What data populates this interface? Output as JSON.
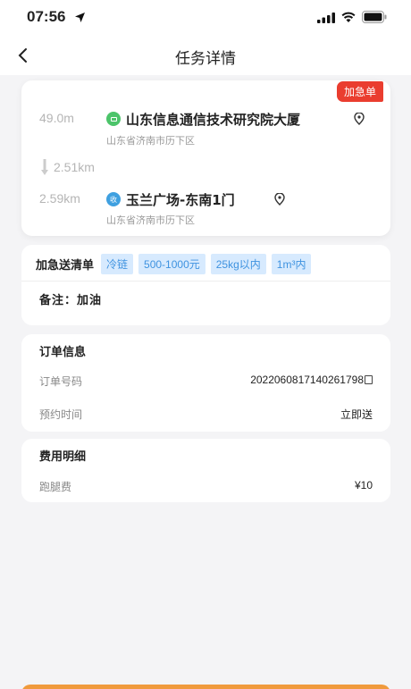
{
  "status_bar": {
    "time": "07:56"
  },
  "nav": {
    "title": "任务详情"
  },
  "route": {
    "badge": "加急单",
    "start": {
      "distance": "49.0m",
      "name": "山东信息通信技术研究院大厦",
      "region": "山东省济南市历下区",
      "icon": "pickup-icon"
    },
    "middle_distance": "2.51km",
    "end": {
      "distance": "2.59km",
      "name": "玉兰广场-东南1门",
      "region": "山东省济南市历下区",
      "icon": "receive-icon",
      "icon_text": "收"
    }
  },
  "tags": {
    "title": "加急送清单",
    "items": [
      "冷链",
      "500-1000元",
      "25kg以内",
      "1m³内"
    ],
    "note": "备注：加油"
  },
  "order": {
    "title": "订单信息",
    "rows": [
      {
        "label": "订单号码",
        "value": "20220608171402617​98"
      },
      {
        "label": "预约时间",
        "value": "立即送"
      }
    ]
  },
  "fee": {
    "title": "费用明细",
    "rows": [
      {
        "label": "跑腿费",
        "value": "¥10"
      }
    ]
  },
  "colors": {
    "accent": "#ea3d2f",
    "tag_bg": "#d7eafe",
    "tag_text": "#3f93e0",
    "start_dot": "#4cc46a",
    "end_dot": "#3fa0e0",
    "bottom_button": "#f09a3c"
  }
}
